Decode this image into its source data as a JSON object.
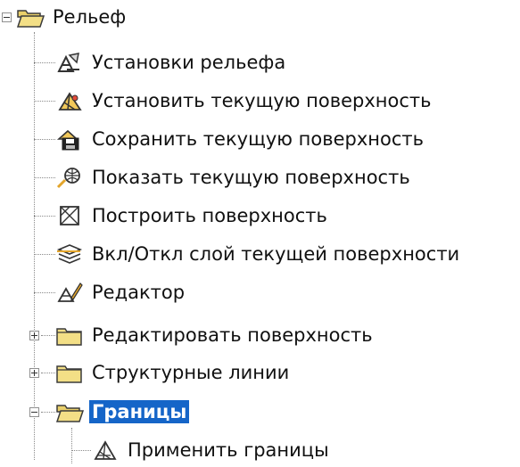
{
  "tree": {
    "root": {
      "label": "Рельеф",
      "expanded": true
    },
    "items": [
      {
        "label": "Установки рельефа",
        "icon": "settings-icon"
      },
      {
        "label": "Установить текущую поверхность",
        "icon": "set-surface-icon"
      },
      {
        "label": "Сохранить текущую поверхность",
        "icon": "save-surface-icon"
      },
      {
        "label": "Показать текущую поверхность",
        "icon": "show-surface-icon"
      },
      {
        "label": "Построить поверхность",
        "icon": "build-surface-icon"
      },
      {
        "label": "Вкл/Откл слой текущей поверхности",
        "icon": "layer-toggle-icon"
      },
      {
        "label": "Редактор",
        "icon": "editor-icon"
      },
      {
        "label": "Редактировать поверхность",
        "icon": "folder-icon",
        "expanded": false
      },
      {
        "label": "Структурные линии",
        "icon": "folder-icon",
        "expanded": false
      },
      {
        "label": "Границы",
        "icon": "folder-open-icon",
        "expanded": true,
        "selected": true
      }
    ],
    "children_of_borders": [
      {
        "label": "Применить границы",
        "icon": "apply-borders-icon"
      }
    ]
  },
  "colors": {
    "selection": "#1565c8",
    "folder": "#f3df86"
  }
}
